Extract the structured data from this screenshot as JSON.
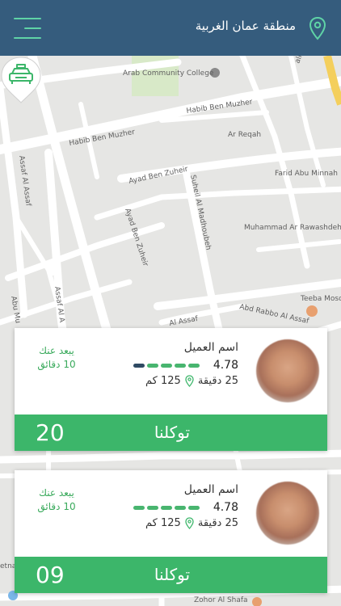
{
  "header": {
    "title": "منطقة عمان الغربية",
    "menu_icon": "hamburger-icon",
    "location_icon": "map-pin-icon"
  },
  "colors": {
    "header_bg": "#355c7d",
    "accent_green": "#3cb66a",
    "menu_accent": "#5fd3a6",
    "rating_dark": "#2f4a63"
  },
  "map": {
    "labels": [
      "Arab Community College",
      "Habib Ben Muzher",
      "Habib Ben Muzher",
      "Ar Reqah",
      "Farid Abu Minnah",
      "Ayad Ben Zuheir",
      "Suheil Al Madhoubeh",
      "Assaf Al Assaf",
      "Ayad Ben Zuheir",
      "Muhammad Ar Rawashdeh",
      "Teeba Mosq",
      "Abd Rabbo Al Assaf",
      "Al Assaf",
      "Assaf Al A",
      "Abu Mu",
      "Zohor Al Shafa",
      "alik",
      "etna",
      "Zah"
    ],
    "marker_icon": "taxi-icon"
  },
  "requests": [
    {
      "name": "اسم العميل",
      "rating": "4.78",
      "rating_bars": {
        "filled": 4,
        "total": 5
      },
      "minutes": "25 دقيقة",
      "distance": "125 كم",
      "away_line1": "يبعد عنك",
      "away_line2": "10 دقائق",
      "action": "توكلنا",
      "count": "20"
    },
    {
      "name": "اسم العميل",
      "rating": "4.78",
      "rating_bars": {
        "filled": 5,
        "total": 5
      },
      "minutes": "25 دقيقة",
      "distance": "125 كم",
      "away_line1": "يبعد عنك",
      "away_line2": "10 دقائق",
      "action": "توكلنا",
      "count": "09"
    }
  ]
}
